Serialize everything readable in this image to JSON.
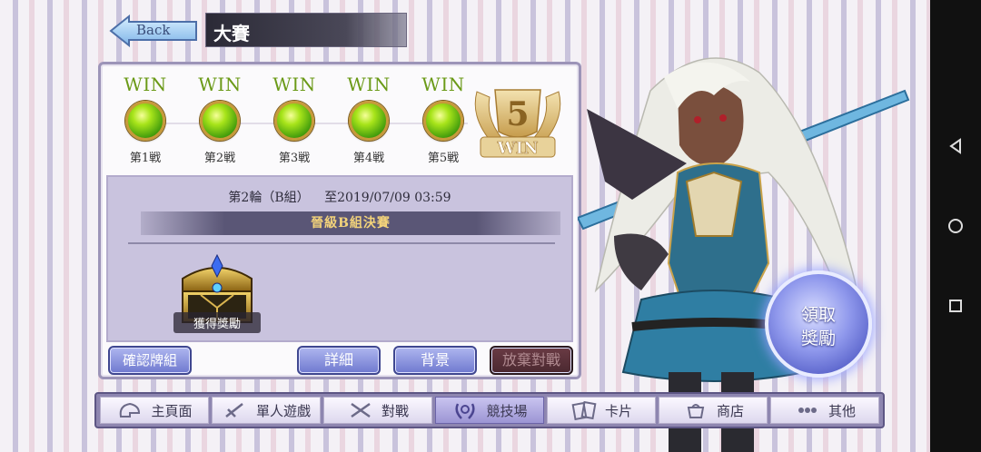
{
  "header": {
    "back_label": "Back",
    "title": "大賽"
  },
  "matches": [
    {
      "result": "WIN",
      "label": "第1戦"
    },
    {
      "result": "WIN",
      "label": "第2戦"
    },
    {
      "result": "WIN",
      "label": "第3戦"
    },
    {
      "result": "WIN",
      "label": "第4戦"
    },
    {
      "result": "WIN",
      "label": "第5戦"
    }
  ],
  "badge": {
    "count": "5",
    "text": "WIN"
  },
  "round": {
    "round_label": "第2輪（B組）",
    "deadline": "至2019/07/09 03:59"
  },
  "stage": "晉級B組決賽",
  "reward": {
    "label": "獲得獎勵"
  },
  "buttons": {
    "confirm_deck": "確認牌組",
    "detail": "詳細",
    "background": "背景",
    "abandon": "放棄對戰"
  },
  "claim": {
    "line1": "領取",
    "line2": "獎勵"
  },
  "nav": [
    {
      "label": "主頁面",
      "icon": "home-icon"
    },
    {
      "label": "單人遊戲",
      "icon": "sword-single-icon"
    },
    {
      "label": "對戰",
      "icon": "crossed-swords-icon"
    },
    {
      "label": "競技場",
      "icon": "arena-laurel-icon"
    },
    {
      "label": "卡片",
      "icon": "cards-icon"
    },
    {
      "label": "商店",
      "icon": "shop-icon"
    },
    {
      "label": "其他",
      "icon": "other-icon"
    }
  ],
  "colors": {
    "win_green": "#6b9a18",
    "button_blue": "#6f79cf",
    "nav_active": "#9c95d4",
    "stage_text": "#f3d37a"
  }
}
